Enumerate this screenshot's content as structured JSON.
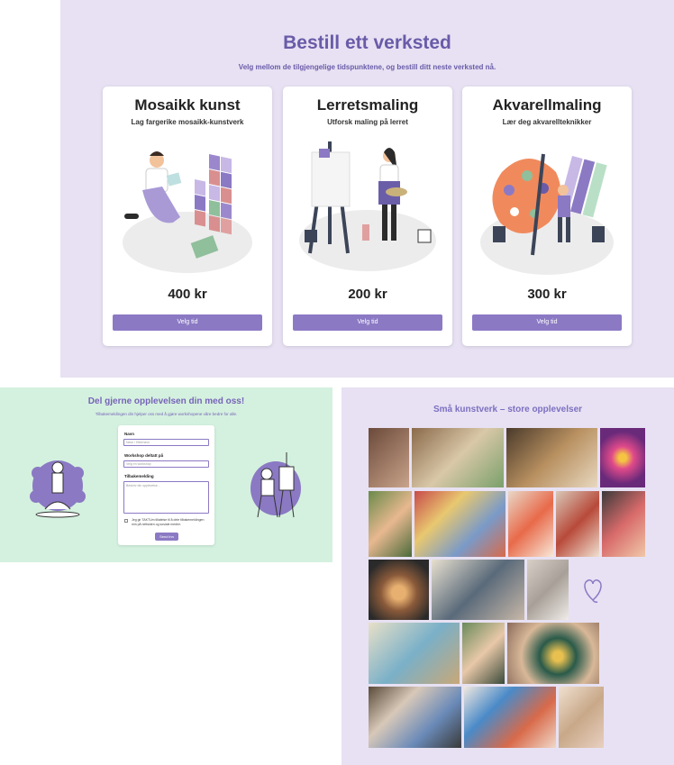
{
  "booking": {
    "title": "Bestill ett verksted",
    "subtitle": "Velg mellom de tilgjengelige tidspunktene, og bestill ditt neste verksted nå.",
    "cards": [
      {
        "title": "Mosaikk kunst",
        "subtitle": "Lag fargerike mosaikk-kunstverk",
        "price": "400 kr",
        "button": "Velg tid",
        "illustration": "mosaic-artist-illustration"
      },
      {
        "title": "Lerretsmaling",
        "subtitle": "Utforsk maling på lerret",
        "price": "200 kr",
        "button": "Velg tid",
        "illustration": "canvas-painter-illustration"
      },
      {
        "title": "Akvarellmaling",
        "subtitle": "Lær deg akvarellteknikker",
        "price": "300 kr",
        "button": "Velg tid",
        "illustration": "watercolor-painter-illustration"
      }
    ]
  },
  "share": {
    "title": "Del gjerne opplevelsen din med oss!",
    "subtitle": "Tilbakemeldingen din hjelper oss med å gjøre workshopene våre bedre for alle.",
    "form": {
      "name_label": "Navn",
      "name_placeholder": "Navn / Etternavn",
      "workshop_label": "Workshop deltatt på",
      "workshop_placeholder": "Velg en workshop",
      "feedback_label": "Tilbakemelding",
      "feedback_placeholder": "Beskriv din opplevelse...",
      "consent_text": "Jeg gir TAKTUm tillatelse til å dele tilbakemeldingen min på nettsiden og sosiale medier.",
      "send_button": "Send inn"
    }
  },
  "gallery": {
    "title": "Små kunstverk – store opplevelser"
  },
  "colors": {
    "accent": "#8b79c4",
    "title_purple": "#6a5ba8",
    "lavender_bg": "#e7e1f3",
    "mint_bg": "#d4f1df"
  }
}
